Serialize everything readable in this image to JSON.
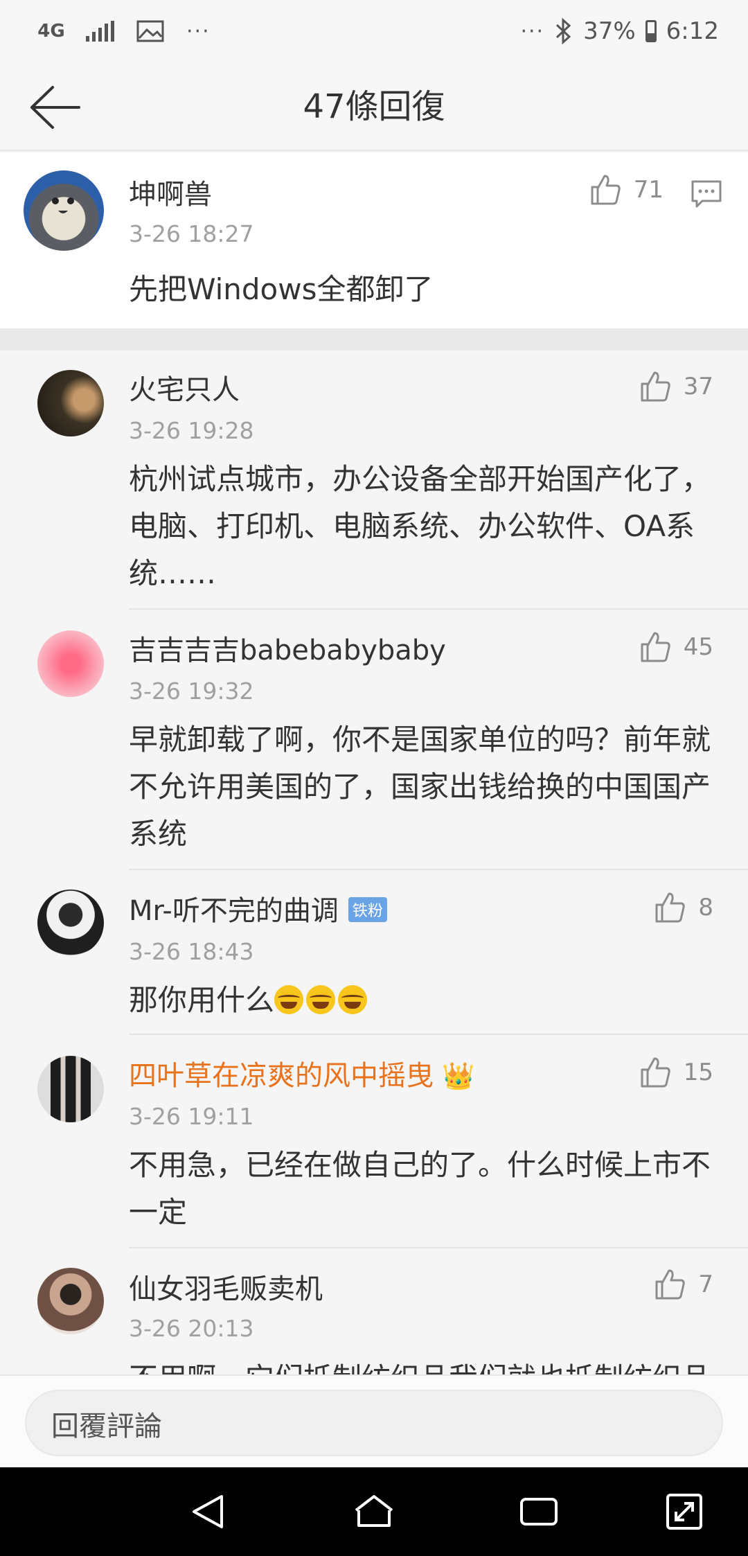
{
  "status_bar": {
    "network": "4G",
    "more_left": "···",
    "more_right": "···",
    "battery": "37%",
    "time": "6:12"
  },
  "header": {
    "title": "47條回復"
  },
  "main_comment": {
    "user": "坤啊兽",
    "time": "3-26 18:27",
    "text": "先把Windows全都卸了",
    "likes": "71"
  },
  "replies": [
    {
      "user": "火宅只人",
      "time": "3-26 19:28",
      "text": "杭州试点城市，办公设备全部开始国产化了，电脑、打印机、电脑系统、办公软件、OA系统……",
      "likes": "37"
    },
    {
      "user": "吉吉吉吉babebabybaby",
      "time": "3-26 19:32",
      "text": "早就卸载了啊，你不是国家单位的吗？前年就不允许用美国的了，国家出钱给换的中国国产系统",
      "likes": "45"
    },
    {
      "user": "Mr-听不完的曲调",
      "badge": "铁粉",
      "time": "3-26 18:43",
      "text": "那你用什么",
      "likes": "8"
    },
    {
      "user": "四叶草在凉爽的风中摇曳",
      "time": "3-26 19:11",
      "text": "不用急，已经在做自己的了。什么时候上市不一定",
      "likes": "15",
      "name_color": "#e8731c"
    },
    {
      "user": "仙女羽毛贩卖机",
      "time": "3-26 20:13",
      "text": "不用啊，它们抵制纺织品我们就也抵制纺织品",
      "likes": "7"
    }
  ],
  "input": {
    "placeholder": "回覆評論"
  }
}
